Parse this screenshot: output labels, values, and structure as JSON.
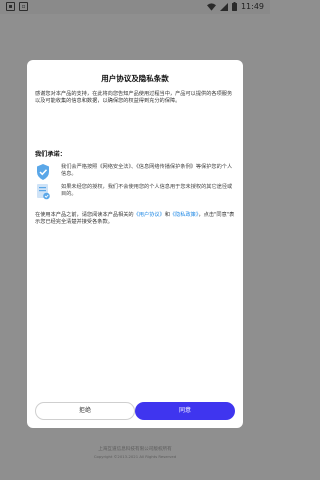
{
  "status_bar": {
    "time": "11:49",
    "left_icons": [
      "notification-icon-1",
      "notification-icon-2"
    ],
    "right_icons": [
      "wifi-icon",
      "signal-icon",
      "battery-icon"
    ]
  },
  "dialog": {
    "title": "用户协议及隐私条款",
    "intro": "感谢您对本产品的支持，在此将向您告知产品使用过程当中，产品可以提供的各项服务以及可能收集的信息和数据，以确保您的权益得到充分的保障。",
    "promise_heading": "我们承诺：",
    "promises": [
      {
        "icon": "shield-check-icon",
        "text": "我们会严格按照《网络安全法》、《信息网络传播保护条例》等保护您的个人信息。"
      },
      {
        "icon": "document-icon",
        "text": "如果未经您的授权，我们不会使用您的个人信息用于您未授权的其它途径或目的。"
      }
    ],
    "agreement": {
      "prefix": "在使用本产品之前，请您阅读本产品相关的",
      "user_link": "《用户协议》",
      "and": "和",
      "privacy_link": "《隐私政策》",
      "suffix": "，点击\"同意\"表示您已经完全清楚并接受各条款。"
    },
    "reject_label": "拒绝",
    "agree_label": "同意"
  },
  "footer": {
    "company": "上海互道信息科技有限公司版权所有",
    "copyright": "Copyright ©2013-2021 All Rights Reserved"
  },
  "colors": {
    "accent": "#3f35ef",
    "link": "#1e88e5",
    "overlay": "#8f8f8f"
  }
}
